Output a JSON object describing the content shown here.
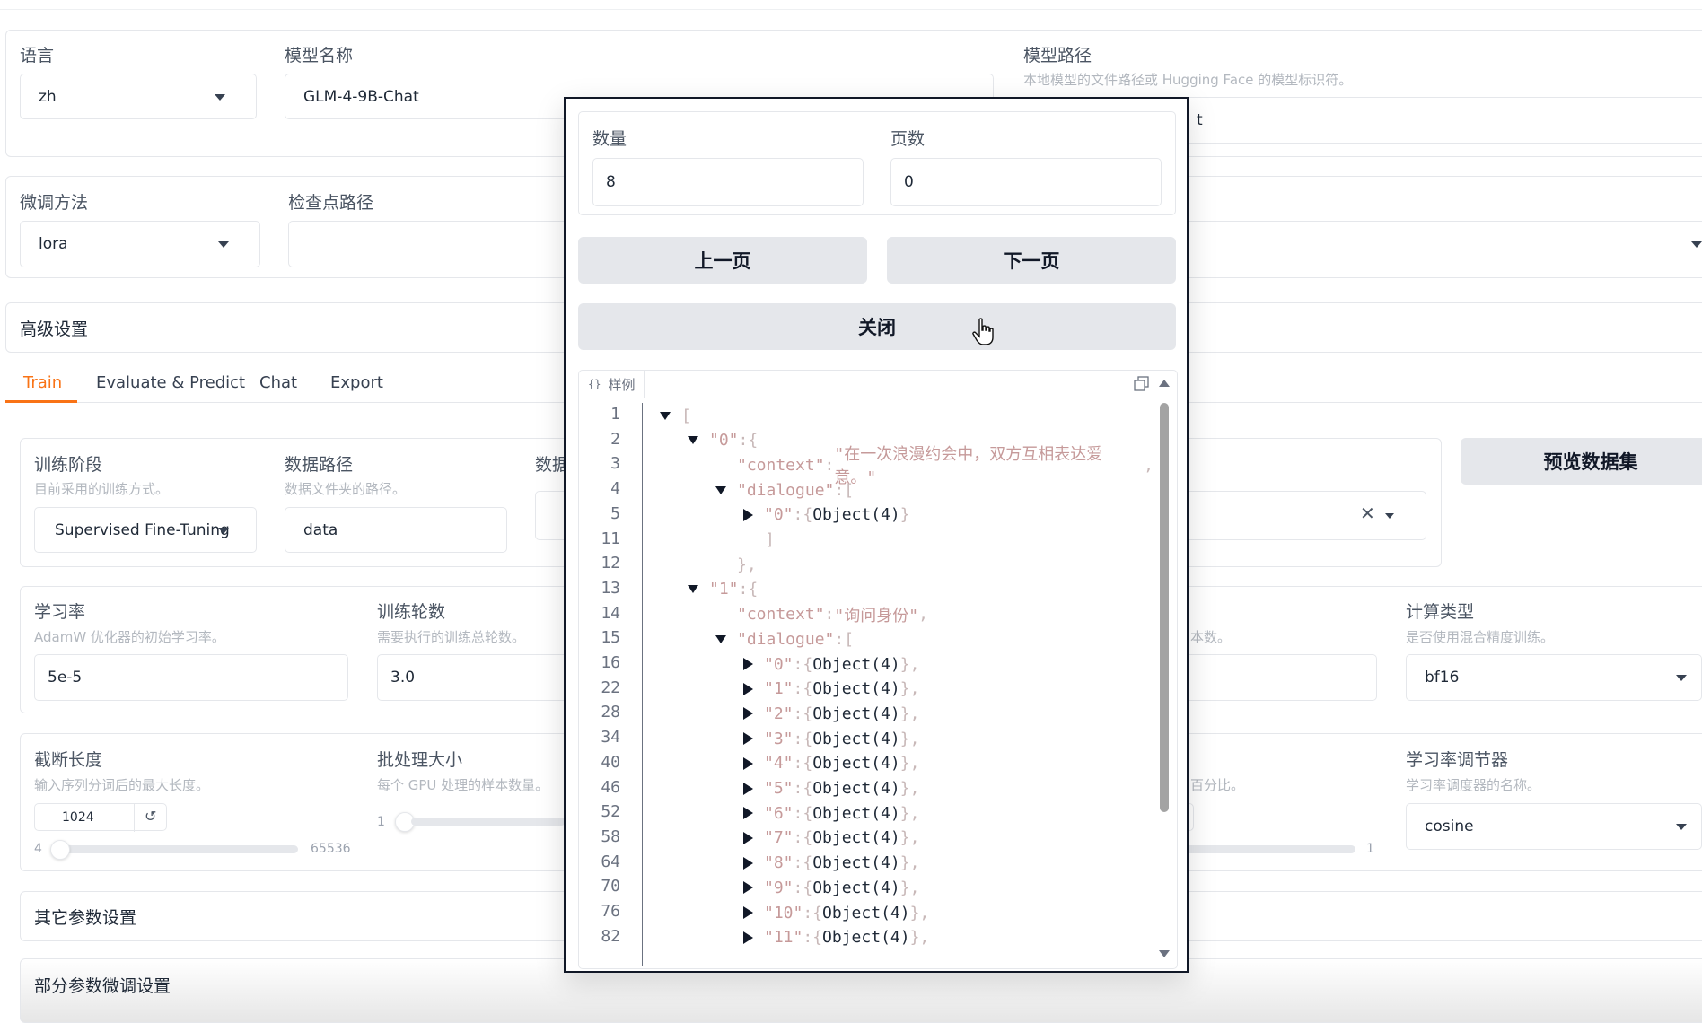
{
  "top": {
    "language_label": "语言",
    "language_value": "zh",
    "model_name_label": "模型名称",
    "model_name_value": "GLM-4-9B-Chat",
    "model_path_label": "模型路径",
    "model_path_info": "本地模型的文件路径或 Hugging Face 的模型标识符。",
    "model_path_value_fragment": "t"
  },
  "row2": {
    "finetune_label": "微调方法",
    "finetune_value": "lora",
    "checkpoint_label": "检查点路径"
  },
  "advanced_label": "高级设置",
  "tabs": [
    "Train",
    "Evaluate & Predict",
    "Chat",
    "Export"
  ],
  "train": {
    "stage_label": "训练阶段",
    "stage_info": "目前采用的训练方式。",
    "stage_value": "Supervised Fine-Tuning",
    "data_dir_label": "数据路径",
    "data_dir_info": "数据文件夹的路径。",
    "data_dir_value": "data",
    "dataset_label_fragment": "数据",
    "preview_button": "预览数据集",
    "lr_label": "学习率",
    "lr_info": "AdamW 优化器的初始学习率。",
    "lr_value": "5e-5",
    "epochs_label": "训练轮数",
    "epochs_info": "需要执行的训练总轮数。",
    "epochs_value": "3.0",
    "samples_info_fragment": "本数。",
    "compute_label": "计算类型",
    "compute_info": "是否使用混合精度训练。",
    "compute_value": "bf16",
    "cutoff_label": "截断长度",
    "cutoff_info": "输入序列分词后的最大长度。",
    "cutoff_value": "1024",
    "cutoff_min": "4",
    "cutoff_max": "65536",
    "cutoff_fraction": 0.015,
    "batch_label": "批处理大小",
    "batch_info": "每个 GPU 处理的样本数量。",
    "batch_min": "1",
    "percent_info_fragment": "百分比。",
    "right_slider_max": "1",
    "scheduler_label": "学习率调节器",
    "scheduler_info": "学习率调度器的名称。",
    "scheduler_value": "cosine",
    "other_params": "其它参数设置",
    "partial_params": "部分参数微调设置"
  },
  "modal": {
    "count_label": "数量",
    "count_value": "8",
    "page_label": "页数",
    "page_value": "0",
    "prev_button": "上一页",
    "next_button": "下一页",
    "close_button": "关闭",
    "json_label": "样例",
    "json_icon": "braces-icon",
    "lines": [
      {
        "n": "1",
        "indent": 0,
        "toggle": "down",
        "parts": [
          [
            "p",
            "["
          ]
        ]
      },
      {
        "n": "2",
        "indent": 1,
        "toggle": "down",
        "parts": [
          [
            "k",
            "\"0\""
          ],
          [
            "p",
            ":"
          ],
          [
            "p",
            "{"
          ]
        ]
      },
      {
        "n": "3",
        "indent": 2,
        "toggle": "",
        "parts": [
          [
            "k",
            "\"context\""
          ],
          [
            "p",
            ":"
          ],
          [
            "s",
            "\"在一次浪漫约会中，双方互相表达爱意。\""
          ],
          [
            "p",
            ","
          ]
        ]
      },
      {
        "n": "4",
        "indent": 2,
        "toggle": "down",
        "parts": [
          [
            "k",
            "\"dialogue\""
          ],
          [
            "p",
            ":"
          ],
          [
            "p",
            "["
          ]
        ]
      },
      {
        "n": "5",
        "indent": 3,
        "toggle": "right",
        "parts": [
          [
            "k",
            "\"0\""
          ],
          [
            "p",
            ":"
          ],
          [
            "p",
            "{"
          ],
          [
            "t",
            " Object(4) "
          ],
          [
            "p",
            "}"
          ]
        ]
      },
      {
        "n": "11",
        "indent": 3,
        "toggle": "",
        "parts": [
          [
            "p",
            "]"
          ]
        ]
      },
      {
        "n": "12",
        "indent": 2,
        "toggle": "",
        "parts": [
          [
            "p",
            "},"
          ]
        ]
      },
      {
        "n": "13",
        "indent": 1,
        "toggle": "down",
        "parts": [
          [
            "k",
            "\"1\""
          ],
          [
            "p",
            ":"
          ],
          [
            "p",
            "{"
          ]
        ]
      },
      {
        "n": "14",
        "indent": 2,
        "toggle": "",
        "parts": [
          [
            "k",
            "\"context\""
          ],
          [
            "p",
            ":"
          ],
          [
            "s",
            "\"询问身份\""
          ],
          [
            "p",
            ","
          ]
        ]
      },
      {
        "n": "15",
        "indent": 2,
        "toggle": "down",
        "parts": [
          [
            "k",
            "\"dialogue\""
          ],
          [
            "p",
            ":"
          ],
          [
            "p",
            "["
          ]
        ]
      },
      {
        "n": "16",
        "indent": 3,
        "toggle": "right",
        "parts": [
          [
            "k",
            "\"0\""
          ],
          [
            "p",
            ":"
          ],
          [
            "p",
            "{"
          ],
          [
            "t",
            " Object(4) "
          ],
          [
            "p",
            "},"
          ]
        ]
      },
      {
        "n": "22",
        "indent": 3,
        "toggle": "right",
        "parts": [
          [
            "k",
            "\"1\""
          ],
          [
            "p",
            ":"
          ],
          [
            "p",
            "{"
          ],
          [
            "t",
            " Object(4) "
          ],
          [
            "p",
            "},"
          ]
        ]
      },
      {
        "n": "28",
        "indent": 3,
        "toggle": "right",
        "parts": [
          [
            "k",
            "\"2\""
          ],
          [
            "p",
            ":"
          ],
          [
            "p",
            "{"
          ],
          [
            "t",
            " Object(4) "
          ],
          [
            "p",
            "},"
          ]
        ]
      },
      {
        "n": "34",
        "indent": 3,
        "toggle": "right",
        "parts": [
          [
            "k",
            "\"3\""
          ],
          [
            "p",
            ":"
          ],
          [
            "p",
            "{"
          ],
          [
            "t",
            " Object(4) "
          ],
          [
            "p",
            "},"
          ]
        ]
      },
      {
        "n": "40",
        "indent": 3,
        "toggle": "right",
        "parts": [
          [
            "k",
            "\"4\""
          ],
          [
            "p",
            ":"
          ],
          [
            "p",
            "{"
          ],
          [
            "t",
            " Object(4) "
          ],
          [
            "p",
            "},"
          ]
        ]
      },
      {
        "n": "46",
        "indent": 3,
        "toggle": "right",
        "parts": [
          [
            "k",
            "\"5\""
          ],
          [
            "p",
            ":"
          ],
          [
            "p",
            "{"
          ],
          [
            "t",
            " Object(4) "
          ],
          [
            "p",
            "},"
          ]
        ]
      },
      {
        "n": "52",
        "indent": 3,
        "toggle": "right",
        "parts": [
          [
            "k",
            "\"6\""
          ],
          [
            "p",
            ":"
          ],
          [
            "p",
            "{"
          ],
          [
            "t",
            " Object(4) "
          ],
          [
            "p",
            "},"
          ]
        ]
      },
      {
        "n": "58",
        "indent": 3,
        "toggle": "right",
        "parts": [
          [
            "k",
            "\"7\""
          ],
          [
            "p",
            ":"
          ],
          [
            "p",
            "{"
          ],
          [
            "t",
            " Object(4) "
          ],
          [
            "p",
            "},"
          ]
        ]
      },
      {
        "n": "64",
        "indent": 3,
        "toggle": "right",
        "parts": [
          [
            "k",
            "\"8\""
          ],
          [
            "p",
            ":"
          ],
          [
            "p",
            "{"
          ],
          [
            "t",
            " Object(4) "
          ],
          [
            "p",
            "},"
          ]
        ]
      },
      {
        "n": "70",
        "indent": 3,
        "toggle": "right",
        "parts": [
          [
            "k",
            "\"9\""
          ],
          [
            "p",
            ":"
          ],
          [
            "p",
            "{"
          ],
          [
            "t",
            " Object(4) "
          ],
          [
            "p",
            "},"
          ]
        ]
      },
      {
        "n": "76",
        "indent": 3,
        "toggle": "right",
        "parts": [
          [
            "k",
            "\"10\""
          ],
          [
            "p",
            ":"
          ],
          [
            "p",
            "{"
          ],
          [
            "t",
            " Object(4) "
          ],
          [
            "p",
            "},"
          ]
        ]
      },
      {
        "n": "82",
        "indent": 3,
        "toggle": "right",
        "parts": [
          [
            "k",
            "\"11\""
          ],
          [
            "p",
            ":"
          ],
          [
            "p",
            "{"
          ],
          [
            "t",
            " Object(4) "
          ],
          [
            "p",
            "},"
          ]
        ]
      }
    ]
  },
  "colors": {
    "accent": "#f97316",
    "button_bg": "#e5e7eb"
  }
}
